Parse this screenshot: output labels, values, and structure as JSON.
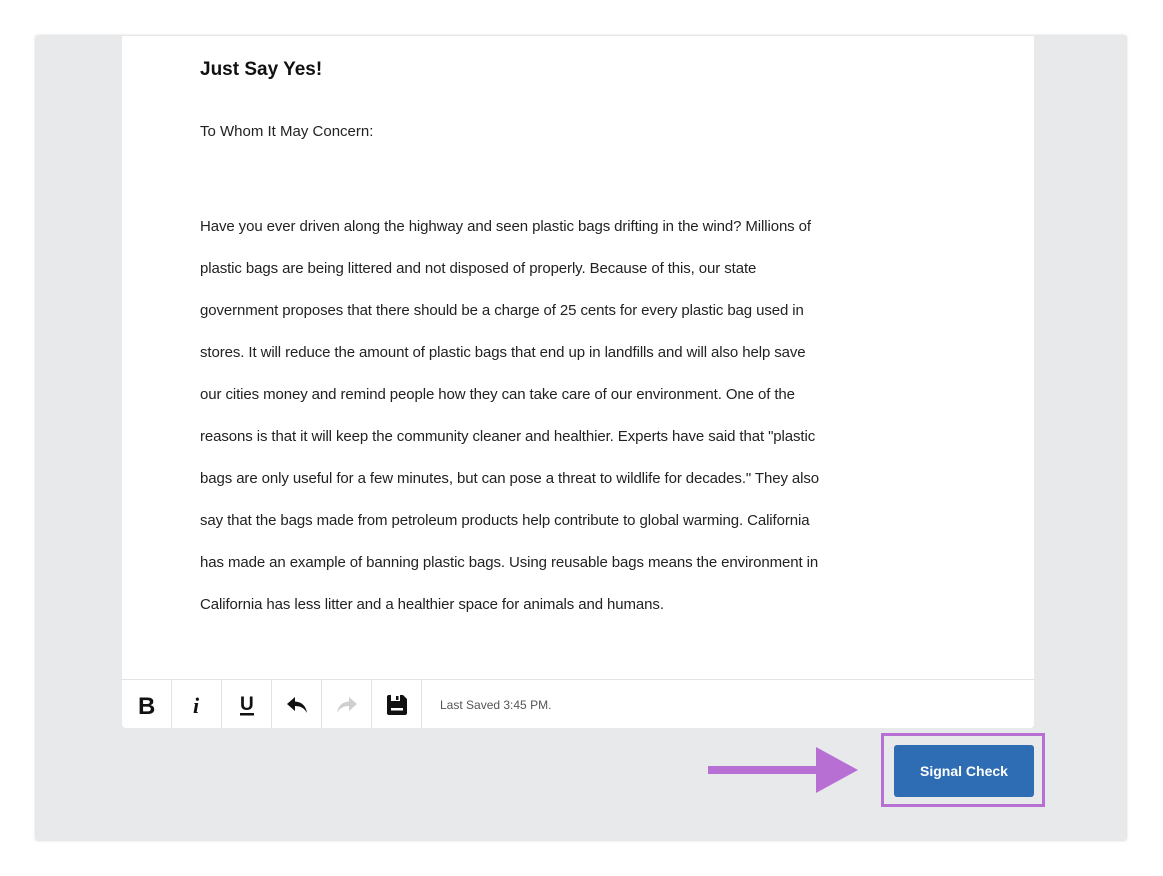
{
  "document": {
    "title": "Just Say Yes!",
    "greeting": "To Whom It May Concern:",
    "lines": [
      "Have you ever driven along the highway and seen plastic bags drifting in the wind? Millions of",
      "plastic bags are being littered and not disposed of properly. Because of this, our state",
      "government proposes that there should be a charge of 25 cents for every plastic bag used in",
      "stores. It will reduce the amount of plastic bags that end up in landfills and will also help save",
      "our cities money and remind people how they can take care of our environment. One of the",
      "reasons is that it will keep the community cleaner and healthier. Experts have said that \"plastic",
      "bags are only useful for a few minutes, but can pose a threat to wildlife for decades.\" They also",
      "say that the bags made from petroleum products help contribute to global warming. California",
      "has made an example of banning plastic bags. Using reusable bags means the environment in",
      "California has less litter and a healthier space for animals and humans."
    ]
  },
  "toolbar": {
    "buttons": [
      {
        "icon": "bold-icon",
        "label": "B"
      },
      {
        "icon": "italic-icon",
        "label": "i"
      },
      {
        "icon": "underline-icon",
        "label": "U"
      },
      {
        "icon": "undo-icon"
      },
      {
        "icon": "redo-icon"
      },
      {
        "icon": "save-icon"
      }
    ],
    "last_saved": "Last Saved 3:45 PM."
  },
  "actions": {
    "signal_check_label": "Signal Check"
  },
  "colors": {
    "frame_bg": "#e8e9eb",
    "button_blue": "#2e6db4",
    "highlight_purple": "#b86fd4"
  }
}
